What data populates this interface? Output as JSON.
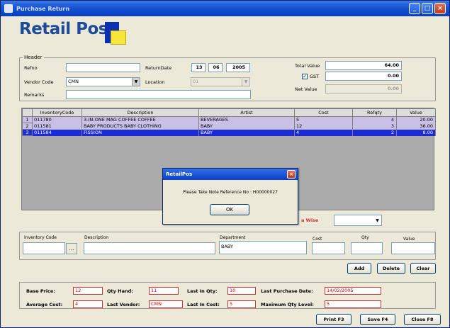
{
  "window": {
    "title": "Purchase Return",
    "minimize": "_",
    "maximize": "□",
    "close": "×"
  },
  "logo": {
    "text": "Retail Pos"
  },
  "header": {
    "legend": "Header",
    "refno_label": "Refno",
    "refno_value": "",
    "vendor_code_label": "Vendor Code",
    "vendor_code_value": "CMN",
    "remarks_label": "Remarks",
    "remarks_value": "",
    "receive_date_label": "ReturnDate",
    "date_day": "13",
    "date_month": "06",
    "date_year": "2005",
    "location_label": "Location",
    "location_value": "01",
    "total_value_label": "Total Value",
    "total_value": "64.00",
    "gst_label": "GST",
    "gst_value": "0.00",
    "net_value_label": "Net Value",
    "net_value": "0.00",
    "gst_checked": true
  },
  "grid": {
    "columns": [
      "",
      "InventoryCode",
      "Description",
      "Artist",
      "Cost",
      "Refqty",
      "Value"
    ],
    "rows": [
      {
        "num": "1",
        "code": "011780",
        "description": "3-IN-ONE MAG COFFEE COFFEE",
        "artist": "BEVERAGES",
        "cost": "5",
        "qty": "4",
        "value": "20.00",
        "selected": false
      },
      {
        "num": "2",
        "code": "011581",
        "description": "BABY PRODUCTS BABY CLOTHING",
        "artist": "BABY",
        "cost": "12",
        "qty": "3",
        "value": "36.00",
        "selected": false
      },
      {
        "num": "3",
        "code": "011584",
        "description": "FISSION",
        "artist": "BABY",
        "cost": "4",
        "qty": "2",
        "value": "8.00",
        "selected": true
      }
    ]
  },
  "dialog": {
    "title": "RetailPos",
    "message": "Please Take Note Reference No : H00000027",
    "ok": "OK",
    "close": "×"
  },
  "mid": {
    "partial_label": "a Wise"
  },
  "entry": {
    "inventory_code_label": "Inventory Code",
    "inventory_code_value": "",
    "ellipsis": "...",
    "description_label": "Description",
    "description_value": "",
    "department_label": "Department",
    "department_value": "BABY",
    "cost_label": "Cost",
    "cost_value": "",
    "qty_label": "Qty",
    "qty_value": "",
    "value_label": "Value",
    "value_value": ""
  },
  "actions": {
    "add": "Add",
    "delete": "Delete",
    "clear": "Clear"
  },
  "info": {
    "base_price_label": "Base Price:",
    "base_price": "12",
    "qty_hand_label": "Qty Hand:",
    "qty_hand": "11",
    "last_in_qty_label": "Last In Qty:",
    "last_in_qty": "10",
    "last_purchase_date_label": "Last Purchase Date:",
    "last_purchase_date": "14/02/2005",
    "average_cost_label": "Average Cost:",
    "average_cost": "4",
    "last_vendor_label": "Last Vendor:",
    "last_vendor": "CMN",
    "last_in_cost_label": "Last In Cost:",
    "last_in_cost": "5",
    "maximum_qty_level_label": "Maximum Qty Level:",
    "maximum_qty_level": "5"
  },
  "footer": {
    "print": "Print F3",
    "save": "Save F4",
    "close": "Close F8"
  },
  "colors": {
    "title_bar": "#1a55d6",
    "selected_row": "#1d2bd6",
    "alt_row": "#c9c0e6",
    "logo_blue": "#1d4a9c",
    "logo_yellow": "#f6e63a"
  }
}
